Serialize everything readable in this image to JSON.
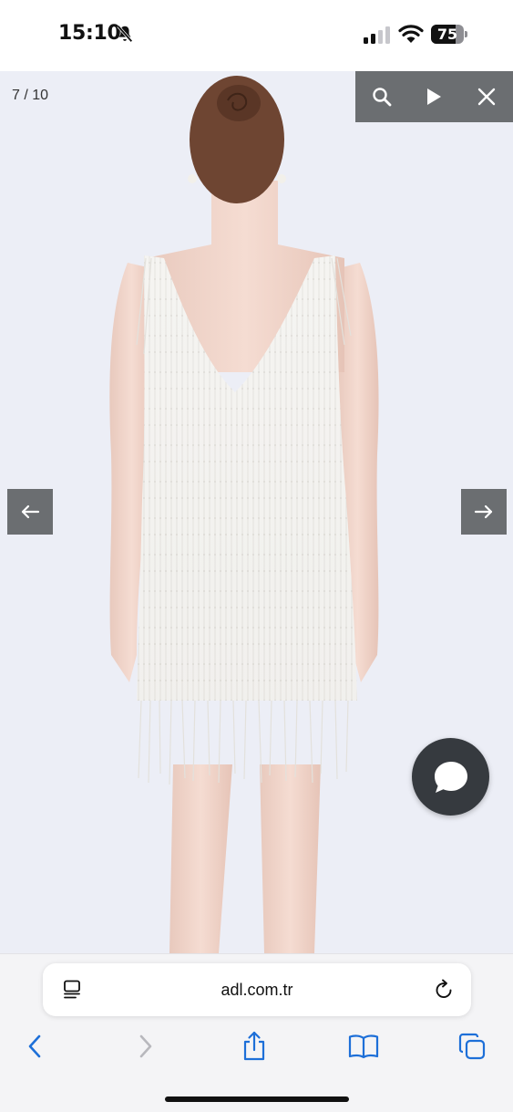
{
  "status_bar": {
    "time": "15:10",
    "battery_level": "75",
    "battery_fraction": 0.75,
    "icons": [
      "mute-bell-icon",
      "cellular-signal-icon",
      "wifi-icon",
      "battery-icon"
    ]
  },
  "gallery": {
    "counter": "7 / 10",
    "image_subject": "model wearing white beaded fringe mini dress, back view",
    "toolbar_icons": [
      "search-icon",
      "play-icon",
      "close-icon"
    ],
    "prev_icon": "arrow-left-icon",
    "next_icon": "arrow-right-icon",
    "chat_icon": "chat-bubble-icon"
  },
  "browser": {
    "url": "adl.com.tr",
    "left_icon": "reader-mode-icon",
    "right_icon": "reload-icon",
    "nav_icons": [
      "back-icon",
      "forward-icon",
      "share-icon",
      "bookmarks-icon",
      "tabs-icon"
    ]
  },
  "colors": {
    "toolbar": "#6b6e71",
    "chat_button": "#363a3f",
    "browser_accent": "#1d6fd8",
    "photo_background": "#eceef6"
  }
}
